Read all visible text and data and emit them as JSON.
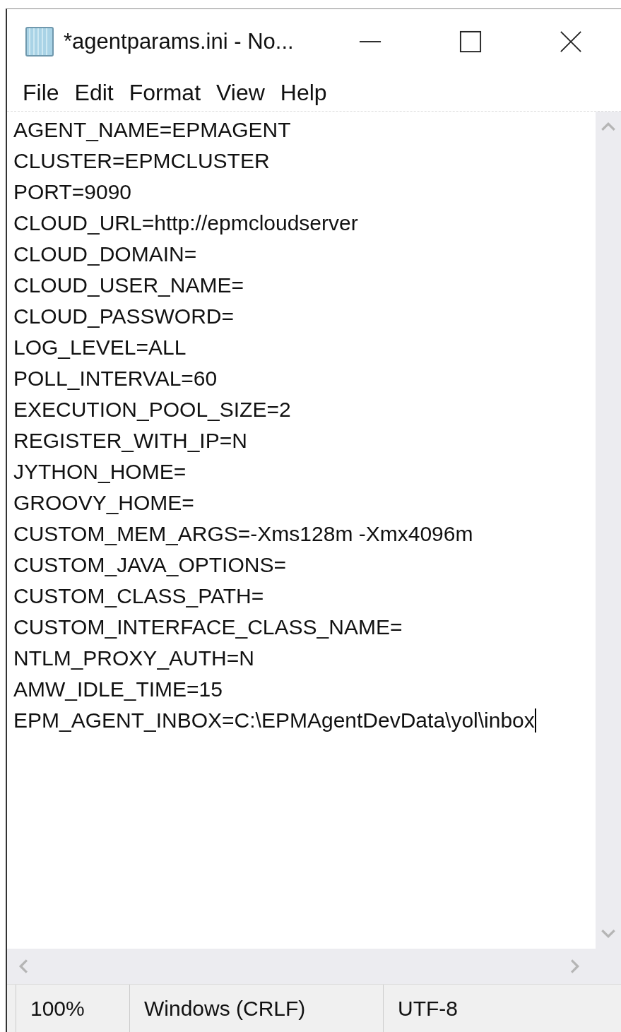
{
  "window": {
    "title": "*agentparams.ini - No..."
  },
  "menu": [
    "File",
    "Edit",
    "Format",
    "View",
    "Help"
  ],
  "editor": {
    "lines": [
      "AGENT_NAME=EPMAGENT",
      "CLUSTER=EPMCLUSTER",
      "PORT=9090",
      "CLOUD_URL=http://epmcloudserver",
      "CLOUD_DOMAIN=",
      "CLOUD_USER_NAME=",
      "CLOUD_PASSWORD=",
      "LOG_LEVEL=ALL",
      "POLL_INTERVAL=60",
      "EXECUTION_POOL_SIZE=2",
      "REGISTER_WITH_IP=N",
      "JYTHON_HOME=",
      "GROOVY_HOME=",
      "CUSTOM_MEM_ARGS=-Xms128m -Xmx4096m",
      "CUSTOM_JAVA_OPTIONS=",
      "CUSTOM_CLASS_PATH=",
      "CUSTOM_INTERFACE_CLASS_NAME=",
      "NTLM_PROXY_AUTH=N",
      "AMW_IDLE_TIME=15",
      "EPM_AGENT_INBOX=C:\\EPMAgentDevData\\yol\\inbox"
    ]
  },
  "status_bar": [
    "100%",
    "Windows (CRLF)",
    "UTF-8"
  ]
}
